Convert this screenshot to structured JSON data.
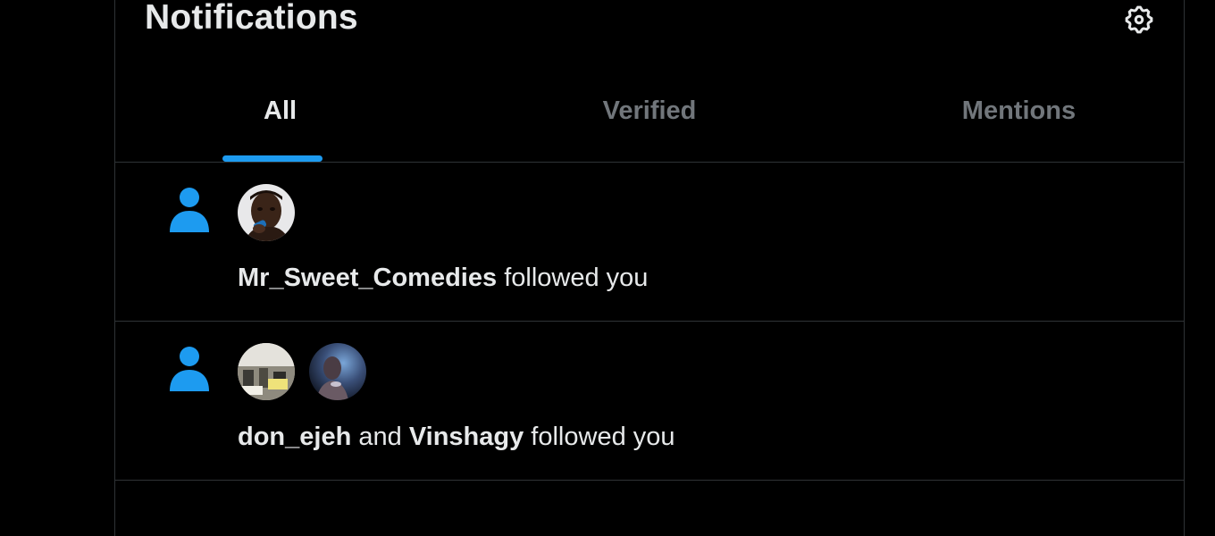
{
  "header": {
    "title": "Notifications",
    "settings_icon": "gear-icon"
  },
  "tabs": [
    {
      "label": "All",
      "active": true
    },
    {
      "label": "Verified",
      "active": false
    },
    {
      "label": "Mentions",
      "active": false
    }
  ],
  "colors": {
    "accent": "#1d9bf0",
    "background": "#000000",
    "text_primary": "#e7e9ea",
    "text_secondary": "#71767b",
    "divider": "#2f3336"
  },
  "notifications": [
    {
      "type_icon": "person-icon",
      "users": [
        "Mr_Sweet_Comedies"
      ],
      "conjunction": "",
      "action": "followed you"
    },
    {
      "type_icon": "person-icon",
      "users": [
        "don_ejeh",
        "Vinshagy"
      ],
      "conjunction": "and",
      "action": "followed you"
    }
  ]
}
